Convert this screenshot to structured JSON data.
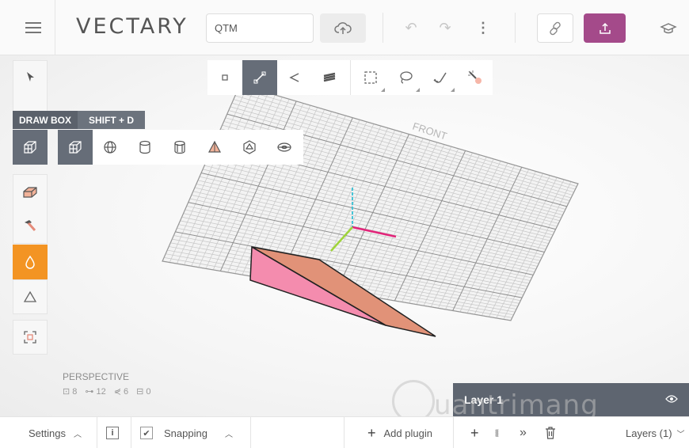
{
  "header": {
    "logo": "VECTARY",
    "file_name": "QTM"
  },
  "tooltip": {
    "label": "DRAW BOX",
    "shortcut": "SHIFT + D"
  },
  "viewport": {
    "front_label": "FRONT",
    "view_mode": "PERSPECTIVE",
    "stats": {
      "objects": "8",
      "edges": "12",
      "vertices": "6",
      "faces": "0"
    }
  },
  "layer_panel": {
    "name": "Layer 1"
  },
  "bottom_bar": {
    "settings": "Settings",
    "info": "i",
    "snapping": "Snapping",
    "add_plugin": "Add plugin",
    "layers": "Layers (1)"
  },
  "watermark": "uantrimang",
  "colors": {
    "accent_purple": "#a44a8a",
    "accent_orange": "#f39423",
    "active_tool": "#666d78",
    "shape_pink": "#f48cae",
    "shape_salmon": "#e19278"
  }
}
